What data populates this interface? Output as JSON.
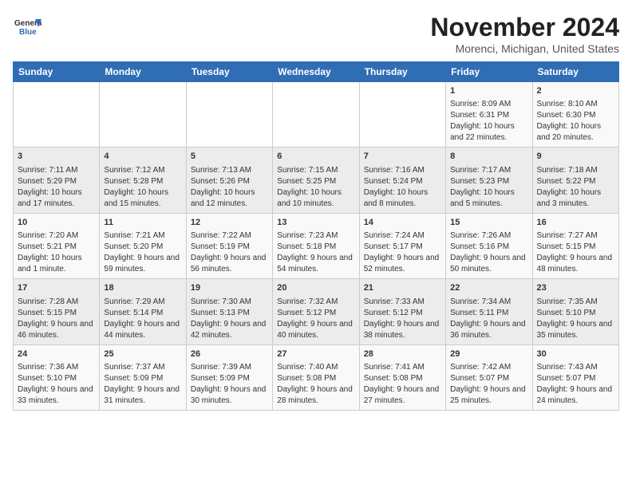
{
  "header": {
    "logo_line1": "General",
    "logo_line2": "Blue",
    "month": "November 2024",
    "location": "Morenci, Michigan, United States"
  },
  "days_of_week": [
    "Sunday",
    "Monday",
    "Tuesday",
    "Wednesday",
    "Thursday",
    "Friday",
    "Saturday"
  ],
  "weeks": [
    [
      {
        "day": "",
        "info": ""
      },
      {
        "day": "",
        "info": ""
      },
      {
        "day": "",
        "info": ""
      },
      {
        "day": "",
        "info": ""
      },
      {
        "day": "",
        "info": ""
      },
      {
        "day": "1",
        "info": "Sunrise: 8:09 AM\nSunset: 6:31 PM\nDaylight: 10 hours and 22 minutes."
      },
      {
        "day": "2",
        "info": "Sunrise: 8:10 AM\nSunset: 6:30 PM\nDaylight: 10 hours and 20 minutes."
      }
    ],
    [
      {
        "day": "3",
        "info": "Sunrise: 7:11 AM\nSunset: 5:29 PM\nDaylight: 10 hours and 17 minutes."
      },
      {
        "day": "4",
        "info": "Sunrise: 7:12 AM\nSunset: 5:28 PM\nDaylight: 10 hours and 15 minutes."
      },
      {
        "day": "5",
        "info": "Sunrise: 7:13 AM\nSunset: 5:26 PM\nDaylight: 10 hours and 12 minutes."
      },
      {
        "day": "6",
        "info": "Sunrise: 7:15 AM\nSunset: 5:25 PM\nDaylight: 10 hours and 10 minutes."
      },
      {
        "day": "7",
        "info": "Sunrise: 7:16 AM\nSunset: 5:24 PM\nDaylight: 10 hours and 8 minutes."
      },
      {
        "day": "8",
        "info": "Sunrise: 7:17 AM\nSunset: 5:23 PM\nDaylight: 10 hours and 5 minutes."
      },
      {
        "day": "9",
        "info": "Sunrise: 7:18 AM\nSunset: 5:22 PM\nDaylight: 10 hours and 3 minutes."
      }
    ],
    [
      {
        "day": "10",
        "info": "Sunrise: 7:20 AM\nSunset: 5:21 PM\nDaylight: 10 hours and 1 minute."
      },
      {
        "day": "11",
        "info": "Sunrise: 7:21 AM\nSunset: 5:20 PM\nDaylight: 9 hours and 59 minutes."
      },
      {
        "day": "12",
        "info": "Sunrise: 7:22 AM\nSunset: 5:19 PM\nDaylight: 9 hours and 56 minutes."
      },
      {
        "day": "13",
        "info": "Sunrise: 7:23 AM\nSunset: 5:18 PM\nDaylight: 9 hours and 54 minutes."
      },
      {
        "day": "14",
        "info": "Sunrise: 7:24 AM\nSunset: 5:17 PM\nDaylight: 9 hours and 52 minutes."
      },
      {
        "day": "15",
        "info": "Sunrise: 7:26 AM\nSunset: 5:16 PM\nDaylight: 9 hours and 50 minutes."
      },
      {
        "day": "16",
        "info": "Sunrise: 7:27 AM\nSunset: 5:15 PM\nDaylight: 9 hours and 48 minutes."
      }
    ],
    [
      {
        "day": "17",
        "info": "Sunrise: 7:28 AM\nSunset: 5:15 PM\nDaylight: 9 hours and 46 minutes."
      },
      {
        "day": "18",
        "info": "Sunrise: 7:29 AM\nSunset: 5:14 PM\nDaylight: 9 hours and 44 minutes."
      },
      {
        "day": "19",
        "info": "Sunrise: 7:30 AM\nSunset: 5:13 PM\nDaylight: 9 hours and 42 minutes."
      },
      {
        "day": "20",
        "info": "Sunrise: 7:32 AM\nSunset: 5:12 PM\nDaylight: 9 hours and 40 minutes."
      },
      {
        "day": "21",
        "info": "Sunrise: 7:33 AM\nSunset: 5:12 PM\nDaylight: 9 hours and 38 minutes."
      },
      {
        "day": "22",
        "info": "Sunrise: 7:34 AM\nSunset: 5:11 PM\nDaylight: 9 hours and 36 minutes."
      },
      {
        "day": "23",
        "info": "Sunrise: 7:35 AM\nSunset: 5:10 PM\nDaylight: 9 hours and 35 minutes."
      }
    ],
    [
      {
        "day": "24",
        "info": "Sunrise: 7:36 AM\nSunset: 5:10 PM\nDaylight: 9 hours and 33 minutes."
      },
      {
        "day": "25",
        "info": "Sunrise: 7:37 AM\nSunset: 5:09 PM\nDaylight: 9 hours and 31 minutes."
      },
      {
        "day": "26",
        "info": "Sunrise: 7:39 AM\nSunset: 5:09 PM\nDaylight: 9 hours and 30 minutes."
      },
      {
        "day": "27",
        "info": "Sunrise: 7:40 AM\nSunset: 5:08 PM\nDaylight: 9 hours and 28 minutes."
      },
      {
        "day": "28",
        "info": "Sunrise: 7:41 AM\nSunset: 5:08 PM\nDaylight: 9 hours and 27 minutes."
      },
      {
        "day": "29",
        "info": "Sunrise: 7:42 AM\nSunset: 5:07 PM\nDaylight: 9 hours and 25 minutes."
      },
      {
        "day": "30",
        "info": "Sunrise: 7:43 AM\nSunset: 5:07 PM\nDaylight: 9 hours and 24 minutes."
      }
    ]
  ]
}
